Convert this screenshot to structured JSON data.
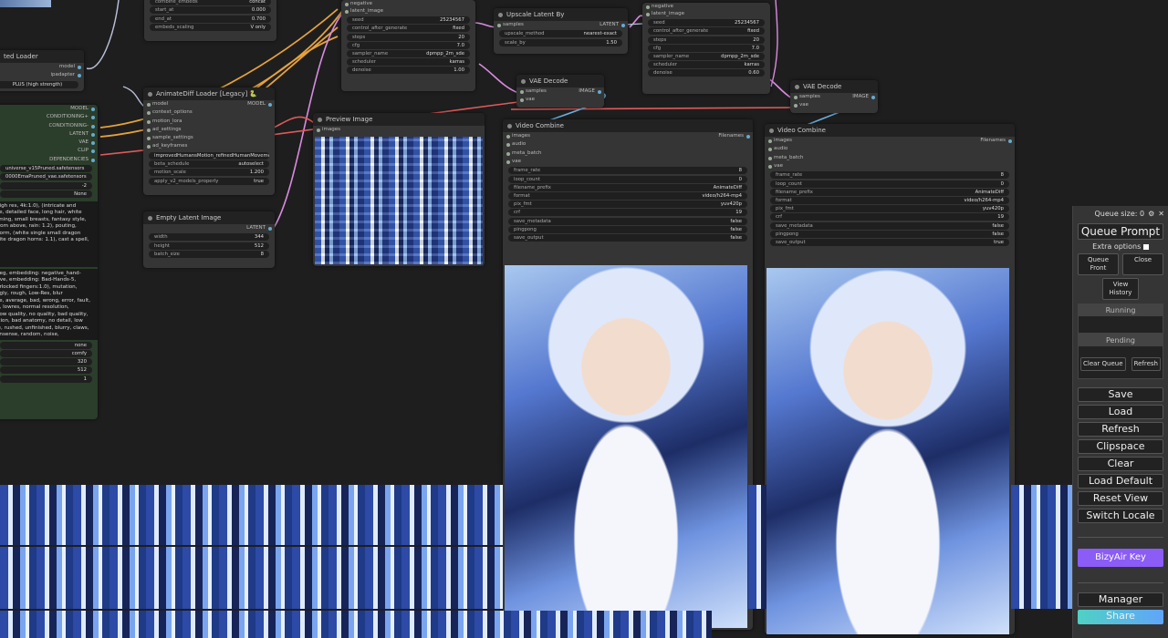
{
  "loader_top": {
    "title": "ted Loader",
    "out_model": "model",
    "out_ipadapter": "ipadapter",
    "preset": "PLUS (high strength)"
  },
  "top_left_node": {
    "row0": {
      "k": "combine_embeds",
      "v": "concat"
    },
    "row1": {
      "k": "start_at",
      "v": "0.000"
    },
    "row2": {
      "k": "end_at",
      "v": "0.700"
    },
    "row3": {
      "k": "embeds_scaling",
      "v": "V only"
    }
  },
  "ksampler1": {
    "in_negative": "negative",
    "in_latent": "latent_image",
    "widgets": [
      {
        "k": "seed",
        "v": "25234567"
      },
      {
        "k": "control_after_generate",
        "v": "fixed"
      },
      {
        "k": "steps",
        "v": "20"
      },
      {
        "k": "cfg",
        "v": "7.0"
      },
      {
        "k": "sampler_name",
        "v": "dpmpp_2m_sde"
      },
      {
        "k": "scheduler",
        "v": "karras"
      },
      {
        "k": "denoise",
        "v": "1.00"
      }
    ]
  },
  "upscale": {
    "title": "Upscale Latent By",
    "in_samples": "samples",
    "out_latent": "LATENT",
    "method": {
      "k": "upscale_method",
      "v": "nearest-exact"
    },
    "scale": {
      "k": "scale_by",
      "v": "1.50"
    }
  },
  "ksampler2": {
    "in_negative": "negative",
    "in_latent": "latent_image",
    "widgets": [
      {
        "k": "seed",
        "v": "25234567"
      },
      {
        "k": "control_after_generate",
        "v": "fixed"
      },
      {
        "k": "steps",
        "v": "20"
      },
      {
        "k": "cfg",
        "v": "7.0"
      },
      {
        "k": "sampler_name",
        "v": "dpmpp_2m_sde"
      },
      {
        "k": "scheduler",
        "v": "karras"
      },
      {
        "k": "denoise",
        "v": "0.60"
      }
    ]
  },
  "vae_decode1": {
    "title": "VAE Decode",
    "in_samples": "samples",
    "in_vae": "vae",
    "out_image": "IMAGE"
  },
  "vae_decode2": {
    "title": "VAE Decode",
    "in_samples": "samples",
    "in_vae": "vae",
    "out_image": "IMAGE"
  },
  "checkpoint_node": {
    "outs": [
      "MODEL",
      "CONDITIONING+",
      "CONDITIONING-",
      "LATENT",
      "VAE",
      "CLIP",
      "DEPENDENCIES"
    ],
    "widgets": [
      "universe_v15Pruned.safetensors",
      "0000EmaPruned_vae.safetensors",
      "-2",
      "None"
    ],
    "positive": "high res, 4k:1.0), (intricate and\nce, detailed face, long hair, white\nrming, small breasts, fantasy style,\nfrom above, rain: 1.2), pouting,\niform, (white single small dragon\nhite dragon horns: 1.1), cast a spell,",
    "negative": "neg, embedding: negative_hand-\ntive, embedding: Bad-Hands-5,\nerlocked fingers:1.0), mutation,\nugly, rough, Low-Res, blur\nce, average, bad, wrong, error, fault,\nn, lowres, normal resolution,\n low quality, no quality, bad quality,\nrtion, bad anatomy, no detail, low\nle, rushed, unfinished, blurry, claws,\nonsense, random, noise,",
    "bottom_widgets": [
      "none",
      "comfy",
      "320",
      "512",
      "1"
    ]
  },
  "animatediff": {
    "title": "AnimateDiff Loader [Legacy]",
    "badge": "🐍",
    "ins": [
      "model",
      "context_options",
      "motion_lora",
      "ad_settings",
      "sample_settings",
      "ad_keyframes"
    ],
    "out_model": "MODEL",
    "model_name": "improvedHumansMotion_refinedHumanMovement.ckpt",
    "widgets": [
      {
        "k": "beta_schedule",
        "v": "autoselect"
      },
      {
        "k": "motion_scale",
        "v": "1.200"
      },
      {
        "k": "apply_v2_models_properly",
        "v": "true"
      }
    ]
  },
  "preview": {
    "title": "Preview Image",
    "in_images": "images"
  },
  "empty_latent": {
    "title": "Empty Latent Image",
    "out": "LATENT",
    "widgets": [
      {
        "k": "width",
        "v": "344"
      },
      {
        "k": "height",
        "v": "512"
      },
      {
        "k": "batch_size",
        "v": "8"
      }
    ]
  },
  "video1": {
    "title": "Video Combine",
    "ins": [
      "images",
      "audio",
      "meta_batch",
      "vae"
    ],
    "out": "Filenames",
    "widgets": [
      {
        "k": "frame_rate",
        "v": "8"
      },
      {
        "k": "loop_count",
        "v": "0"
      },
      {
        "k": "filename_prefix",
        "v": "AnimateDiff"
      },
      {
        "k": "format",
        "v": "video/h264-mp4"
      },
      {
        "k": "pix_fmt",
        "v": "yuv420p"
      },
      {
        "k": "crf",
        "v": "19"
      },
      {
        "k": "save_metadata",
        "v": "false"
      },
      {
        "k": "pingpong",
        "v": "false"
      },
      {
        "k": "save_output",
        "v": "false"
      }
    ]
  },
  "video2": {
    "title": "Video Combine",
    "ins": [
      "images",
      "audio",
      "meta_batch",
      "vae"
    ],
    "out": "Filenames",
    "widgets": [
      {
        "k": "frame_rate",
        "v": "8"
      },
      {
        "k": "loop_count",
        "v": "0"
      },
      {
        "k": "filename_prefix",
        "v": "AnimateDiff"
      },
      {
        "k": "format",
        "v": "video/h264-mp4"
      },
      {
        "k": "pix_fmt",
        "v": "yuv420p"
      },
      {
        "k": "crf",
        "v": "19"
      },
      {
        "k": "save_metadata",
        "v": "false"
      },
      {
        "k": "pingpong",
        "v": "false"
      },
      {
        "k": "save_output",
        "v": "true"
      }
    ]
  },
  "panel": {
    "queue_size": "Queue size: 0",
    "queue_prompt": "Queue Prompt",
    "extra_options": "Extra options",
    "queue_front": "Queue Front",
    "close": "Close",
    "view_history": "View History",
    "running": "Running",
    "pending": "Pending",
    "clear_queue": "Clear Queue",
    "refresh_small": "Refresh",
    "buttons": [
      "Save",
      "Load",
      "Refresh",
      "Clipspace",
      "Clear",
      "Load Default",
      "Reset View",
      "Switch Locale"
    ],
    "bizyair": "BizyAir Key",
    "manager": "Manager",
    "share": "Share",
    "bizyair_color": "#8b5cf6"
  }
}
